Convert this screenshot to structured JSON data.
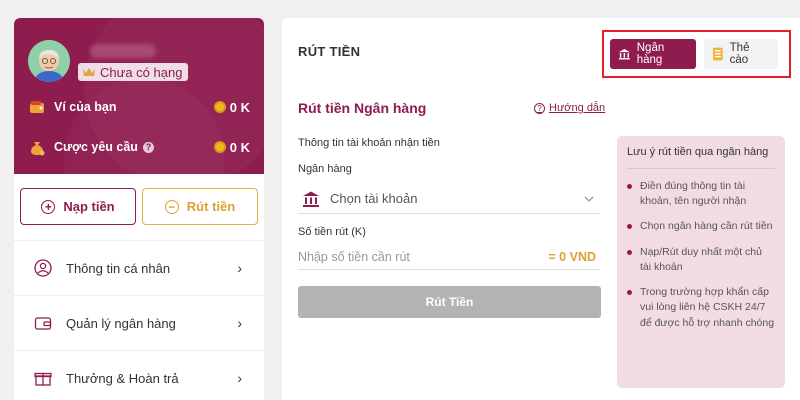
{
  "profile": {
    "rank": "Chưa có hạng",
    "wallet_label": "Ví của bạn",
    "wallet_amount": "0 K",
    "request_label": "Cược yêu cầu",
    "request_amount": "0 K"
  },
  "actions": {
    "deposit": "Nạp tiền",
    "withdraw": "Rút tiền"
  },
  "menu": [
    {
      "label": "Thông tin cá nhân",
      "icon": "user-icon"
    },
    {
      "label": "Quản lý ngân hàng",
      "icon": "wallet-icon"
    },
    {
      "label": "Thưởng & Hoàn trả",
      "icon": "gift-icon"
    }
  ],
  "panel": {
    "title": "RÚT TIỀN",
    "tabs": [
      {
        "label": "Ngân hàng",
        "active": true
      },
      {
        "label": "Thẻ cào",
        "active": false
      }
    ],
    "form_title": "Rút tiền Ngân hàng",
    "guide": "Hướng dẫn",
    "account_info_label": "Thông tin tài khoản nhận tiền",
    "bank_label": "Ngân hàng",
    "bank_select": "Chọn tài khoản",
    "amount_label": "Số tiền rút (K)",
    "amount_placeholder": "Nhập số tiền cần rút",
    "amount_conversion": "= 0 VND",
    "submit": "Rút Tiền"
  },
  "notes": {
    "title": "Lưu ý rút tiền qua ngân hàng",
    "items": [
      "Điền đúng thông tin tài khoản, tên người nhận",
      "Chọn ngân hàng cần rút tiền",
      "Nạp/Rút duy nhất một chủ tài khoản",
      "Trong trường hợp khẩn cấp vui lòng liên hệ CSKH 24/7 để được hỗ trợ nhanh chóng"
    ]
  },
  "colors": {
    "brand": "#8e1c4f",
    "gold": "#dca135",
    "highlight_box": "#e61e2b"
  }
}
